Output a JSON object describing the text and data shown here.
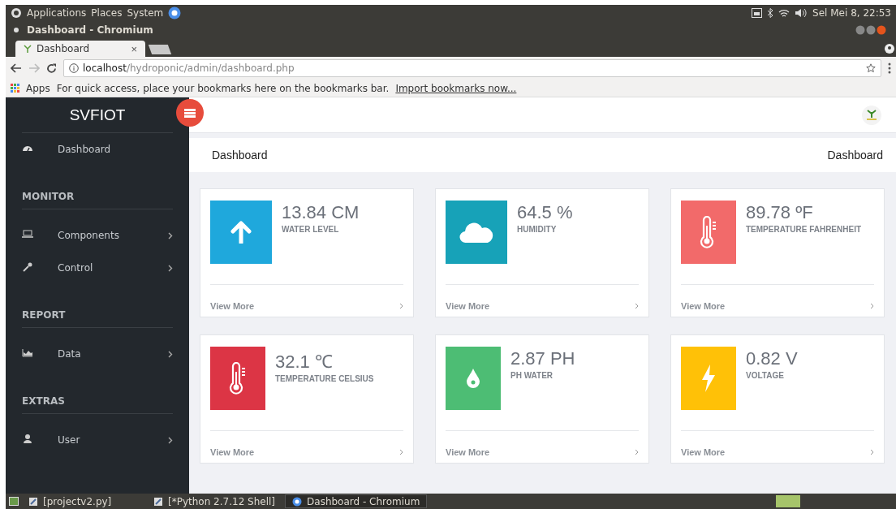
{
  "top_panel": {
    "menus": [
      "Applications",
      "Places",
      "System"
    ],
    "clock": "Sel Mei 8, 22:53"
  },
  "window": {
    "title": "Dashboard - Chromium"
  },
  "tabs": [
    {
      "label": "Dashboard",
      "selected": true,
      "close": "×"
    }
  ],
  "address_bar": {
    "host": "localhost",
    "path": "/hydroponic/admin/dashboard.php"
  },
  "bookmarks_bar": {
    "apps": "Apps",
    "message": "For quick access, place your bookmarks here on the bookmarks bar.",
    "link": "Import bookmarks now..."
  },
  "sidebar": {
    "brand": "SVFIOT",
    "items": [
      {
        "kind": "item",
        "label": "Dashboard",
        "arrow": false
      },
      {
        "kind": "header",
        "label": "MONITOR"
      },
      {
        "kind": "item",
        "label": "Components",
        "arrow": true
      },
      {
        "kind": "item",
        "label": "Control",
        "arrow": true
      },
      {
        "kind": "header",
        "label": "REPORT"
      },
      {
        "kind": "item",
        "label": "Data",
        "arrow": true
      },
      {
        "kind": "header",
        "label": "EXTRAS"
      },
      {
        "kind": "item",
        "label": "User",
        "arrow": true
      }
    ]
  },
  "breadcrumb": {
    "title": "Dashboard",
    "current": "Dashboard"
  },
  "cards": [
    {
      "value": "13.84 CM",
      "label": "WATER LEVEL",
      "color": "#1fa8dc",
      "footer": "View More"
    },
    {
      "value": "64.5 %",
      "label": "HUMIDITY",
      "color": "#17a2b8",
      "footer": "View More"
    },
    {
      "value": "89.78 ºF",
      "label": "TEMPERATURE FAHRENHEIT",
      "color": "#f26a6a",
      "footer": "View More"
    },
    {
      "value": "32.1 ℃",
      "label": "TEMPERATURE CELSIUS",
      "color": "#dc3545",
      "footer": "View More"
    },
    {
      "value": "2.87 PH",
      "label": "PH WATER",
      "color": "#4dbd74",
      "footer": "View More"
    },
    {
      "value": "0.82 V",
      "label": "VOLTAGE",
      "color": "#ffc107",
      "footer": "View More"
    }
  ],
  "taskbar": [
    {
      "label": "[projectv2.py]",
      "selected": false
    },
    {
      "label": "[*Python 2.7.12 Shell]",
      "selected": false
    },
    {
      "label": "Dashboard - Chromium",
      "selected": true
    }
  ]
}
